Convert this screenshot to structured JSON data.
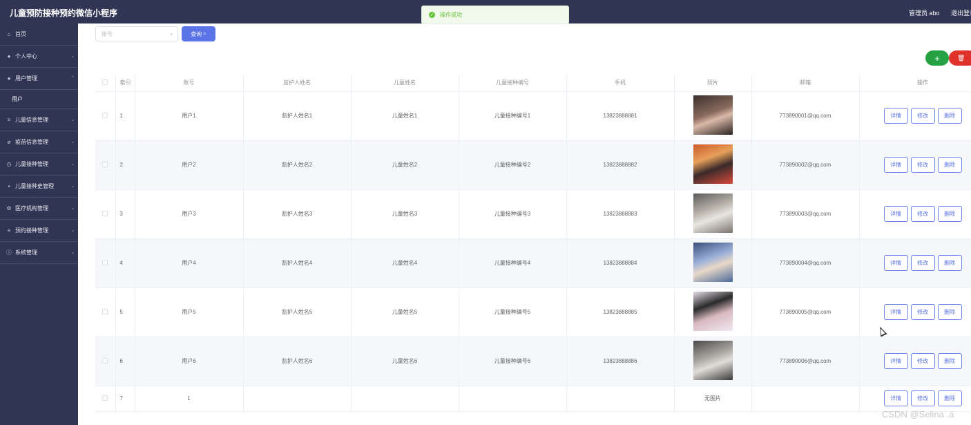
{
  "header": {
    "title": "儿童预防接种预约微信小程序",
    "admin": "管理员 abo",
    "logout": "退出登录"
  },
  "toast": {
    "text": "操作成功"
  },
  "sidebar": {
    "items": [
      {
        "label": "首页",
        "icon": "home-icon"
      },
      {
        "label": "个人中心",
        "icon": "user-icon"
      },
      {
        "label": "用户管理",
        "icon": "user-icon"
      },
      {
        "label": "儿童信息管理",
        "icon": "list-icon"
      },
      {
        "label": "疫苗信息管理",
        "icon": "leaf-icon"
      },
      {
        "label": "儿童接种管理",
        "icon": "clock-icon"
      },
      {
        "label": "儿童接种史管理",
        "icon": "chat-icon"
      },
      {
        "label": "医疗机构管理",
        "icon": "gear-icon"
      },
      {
        "label": "预约接种管理",
        "icon": "list-icon"
      },
      {
        "label": "系统管理",
        "icon": "info-icon"
      }
    ],
    "submenu": {
      "label": "用户"
    }
  },
  "search": {
    "placeholder": "账号",
    "button": "查询"
  },
  "table": {
    "headers": [
      "索引",
      "账号",
      "监护人姓名",
      "儿童姓名",
      "儿童接种编号",
      "手机",
      "照片",
      "邮箱",
      "操作"
    ],
    "actions": {
      "detail": "详情",
      "edit": "修改",
      "delete": "删除"
    },
    "rows": [
      {
        "index": "1",
        "account": "用户1",
        "guardian": "监护人姓名1",
        "child": "儿童姓名1",
        "vacc_no": "儿童接种编号1",
        "phone": "13823888881",
        "photo": "photo",
        "email": "773890001@qq.com"
      },
      {
        "index": "2",
        "account": "用户2",
        "guardian": "监护人姓名2",
        "child": "儿童姓名2",
        "vacc_no": "儿童接种编号2",
        "phone": "13823888882",
        "photo": "photo",
        "email": "773890002@qq.com"
      },
      {
        "index": "3",
        "account": "用户3",
        "guardian": "监护人姓名3",
        "child": "儿童姓名3",
        "vacc_no": "儿童接种编号3",
        "phone": "13823888883",
        "photo": "photo",
        "email": "773890003@qq.com"
      },
      {
        "index": "4",
        "account": "用户4",
        "guardian": "监护人姓名4",
        "child": "儿童姓名4",
        "vacc_no": "儿童接种编号4",
        "phone": "13823888884",
        "photo": "photo",
        "email": "773890004@qq.com"
      },
      {
        "index": "5",
        "account": "用户5",
        "guardian": "监护人姓名5",
        "child": "儿童姓名5",
        "vacc_no": "儿童接种编号5",
        "phone": "13823888885",
        "photo": "photo",
        "email": "773890005@qq.com"
      },
      {
        "index": "6",
        "account": "用户6",
        "guardian": "监护人姓名6",
        "child": "儿童姓名6",
        "vacc_no": "儿童接种编号6",
        "phone": "13823888886",
        "photo": "photo",
        "email": "773890006@qq.com"
      },
      {
        "index": "7",
        "account": "1",
        "guardian": "",
        "child": "",
        "vacc_no": "",
        "phone": "",
        "photo_text": "无图片",
        "email": ""
      }
    ]
  },
  "watermark": "CSDN @Selina .a",
  "colors": {
    "header_bg": "#2f3553",
    "primary": "#5a73e6",
    "success": "#26a144",
    "danger": "#e0312b"
  }
}
